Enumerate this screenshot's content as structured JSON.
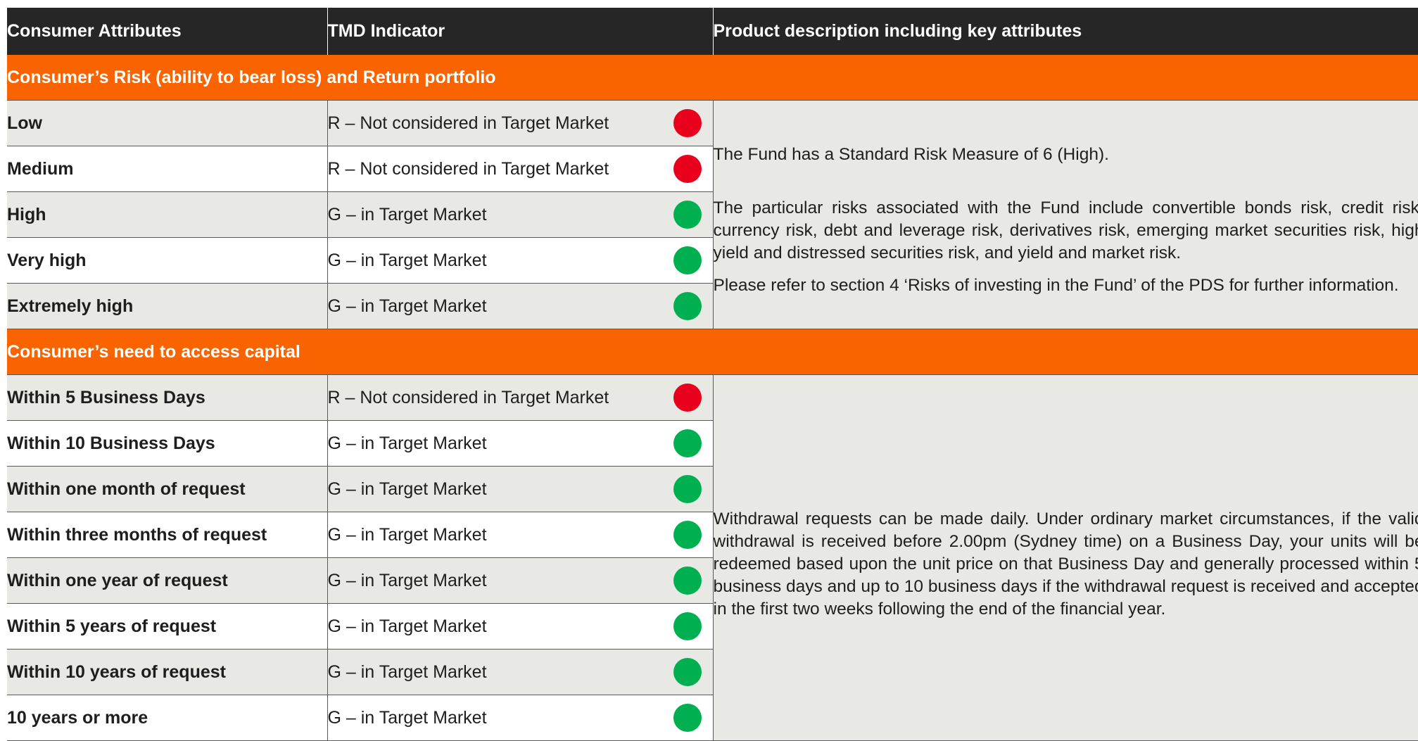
{
  "headers": {
    "col1": "Consumer Attributes",
    "col2": "TMD Indicator",
    "col3": "Product description including key attributes"
  },
  "sections": {
    "risk": {
      "title": "Consumer’s Risk (ability to bear loss) and Return portfolio",
      "rows": [
        {
          "attribute": "Low",
          "indicator": "R – Not considered in Target Market",
          "status": "red"
        },
        {
          "attribute": "Medium",
          "indicator": "R – Not considered in Target Market",
          "status": "red"
        },
        {
          "attribute": "High",
          "indicator": "G – in Target Market",
          "status": "green"
        },
        {
          "attribute": "Very high",
          "indicator": "G – in Target Market",
          "status": "green"
        },
        {
          "attribute": "Extremely high",
          "indicator": "G – in Target Market",
          "status": "green"
        }
      ],
      "description": [
        "The Fund has a Standard Risk Measure of 6 (High).",
        "The particular risks associated with the Fund include convertible bonds risk, credit risk, currency risk, debt and leverage risk, derivatives risk, emerging market securities risk, high yield and distressed securities risk, and yield and market risk.",
        "Please refer to section 4 ‘Risks of investing in the Fund’ of the PDS for further information."
      ]
    },
    "capital": {
      "title": "Consumer’s need to access capital",
      "rows": [
        {
          "attribute": "Within 5 Business Days",
          "indicator": "R – Not considered in Target Market",
          "status": "red"
        },
        {
          "attribute": "Within 10 Business Days",
          "indicator": "G – in Target Market",
          "status": "green"
        },
        {
          "attribute": "Within one month of request",
          "indicator": "G – in Target Market",
          "status": "green"
        },
        {
          "attribute": "Within three months of request",
          "indicator": "G – in Target Market",
          "status": "green"
        },
        {
          "attribute": "Within one year of request",
          "indicator": "G – in Target Market",
          "status": "green"
        },
        {
          "attribute": "Within 5 years of request",
          "indicator": "G – in Target Market",
          "status": "green"
        },
        {
          "attribute": "Within 10 years of request",
          "indicator": "G – in Target Market",
          "status": "green"
        },
        {
          "attribute": "10 years or more",
          "indicator": "G – in Target Market",
          "status": "green"
        }
      ],
      "description": [
        "Withdrawal requests can be made daily. Under ordinary market circumstances, if the valid withdrawal is received before 2.00pm (Sydney time) on a Business Day, your units will be redeemed based upon the unit price on that Business Day and generally processed within 5 business days and up to 10 business days if the withdrawal request is received and accepted in the first two weeks following the end of the financial year."
      ]
    }
  },
  "colors": {
    "header_bg": "#262626",
    "section_bg": "#fa6400",
    "shade_bg": "#e8e8e4",
    "red": "#e8001c",
    "green": "#00b050"
  }
}
